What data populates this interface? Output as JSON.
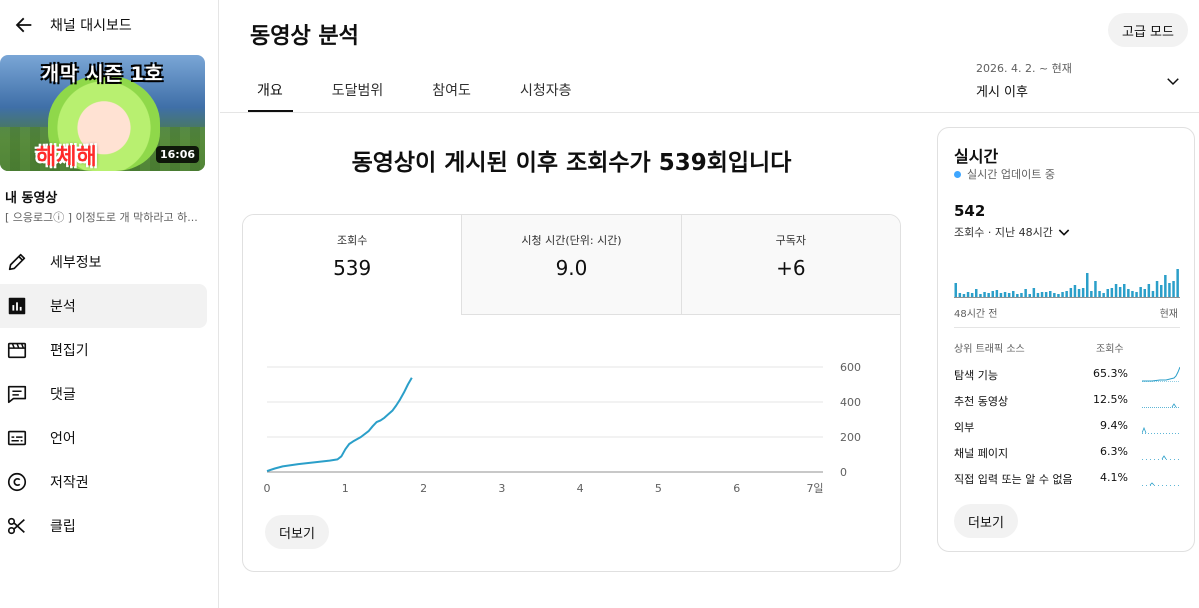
{
  "sidebar": {
    "back_label": "채널 대시보드",
    "video": {
      "thumb_top": "개막 시즌 1호",
      "thumb_bottom": "해체해",
      "duration": "16:06",
      "heading": "내 동영상",
      "title": "[ 으응로그ⓘ ] 이정도로 개 막하라고 하..."
    },
    "items": [
      {
        "label": "세부정보",
        "icon": "pencil-icon"
      },
      {
        "label": "분석",
        "icon": "analytics-icon",
        "active": true
      },
      {
        "label": "편집기",
        "icon": "clapperboard-icon"
      },
      {
        "label": "댓글",
        "icon": "comment-icon"
      },
      {
        "label": "언어",
        "icon": "subtitles-icon"
      },
      {
        "label": "저작권",
        "icon": "copyright-icon"
      },
      {
        "label": "클립",
        "icon": "scissors-icon"
      }
    ]
  },
  "header": {
    "title": "동영상 분석",
    "advanced_label": "고급 모드",
    "tabs": [
      "개요",
      "도달범위",
      "참여도",
      "시청자층"
    ],
    "date_range": "2026. 4. 2. ~ 현재",
    "date_label": "게시 이후"
  },
  "overview": {
    "headline": "동영상이 게시된 이후 조회수가 539회입니다",
    "metrics": [
      {
        "label": "조회수",
        "value": "539"
      },
      {
        "label": "시청 시간(단위: 시간)",
        "value": "9.0"
      },
      {
        "label": "구독자",
        "value": "+6"
      }
    ],
    "more_label": "더보기"
  },
  "chart_data": {
    "type": "line",
    "x_ticks": [
      "0",
      "1",
      "2",
      "3",
      "4",
      "5",
      "6",
      "7일"
    ],
    "y_ticks": [
      "0",
      "200",
      "400",
      "600"
    ],
    "ylim": [
      0,
      600
    ],
    "xlim": [
      0,
      7
    ],
    "series": [
      {
        "color": "#2b9fc9",
        "x": [
          0,
          0.1,
          0.2,
          0.3,
          0.4,
          0.5,
          0.6,
          0.7,
          0.8,
          0.9,
          0.95,
          1.0,
          1.05,
          1.1,
          1.2,
          1.3,
          1.35,
          1.4,
          1.45,
          1.5,
          1.55,
          1.6,
          1.65,
          1.7,
          1.75,
          1.8,
          1.85
        ],
        "y": [
          5,
          20,
          32,
          38,
          45,
          50,
          55,
          60,
          65,
          72,
          90,
          130,
          160,
          175,
          200,
          235,
          262,
          285,
          295,
          310,
          330,
          350,
          380,
          415,
          455,
          500,
          539
        ]
      }
    ]
  },
  "realtime": {
    "title": "실시간",
    "status": "실시간 업데이트 중",
    "count": "542",
    "sub_label": "조회수 · 지난 48시간",
    "bar_values": [
      14,
      4,
      3,
      5,
      4,
      8,
      3,
      5,
      4,
      6,
      7,
      4,
      5,
      4,
      6,
      3,
      4,
      8,
      3,
      9,
      4,
      5,
      5,
      6,
      4,
      3,
      5,
      6,
      9,
      12,
      8,
      9,
      24,
      6,
      16,
      6,
      4,
      8,
      9,
      13,
      10,
      13,
      8,
      6,
      5,
      10,
      8,
      13,
      6,
      16,
      12,
      22,
      14,
      16,
      28
    ],
    "axis_left": "48시간 전",
    "axis_right": "현재",
    "col_source": "상위 트래픽 소스",
    "col_views": "조회수",
    "sources": [
      {
        "name": "탐색 기능",
        "pct": "65.3%"
      },
      {
        "name": "추천 동영상",
        "pct": "12.5%"
      },
      {
        "name": "외부",
        "pct": "9.4%"
      },
      {
        "name": "채널 페이지",
        "pct": "6.3%"
      },
      {
        "name": "직접 입력 또는 알 수 없음",
        "pct": "4.1%"
      }
    ],
    "more_label": "더보기",
    "accent": "#2b9fc9"
  }
}
